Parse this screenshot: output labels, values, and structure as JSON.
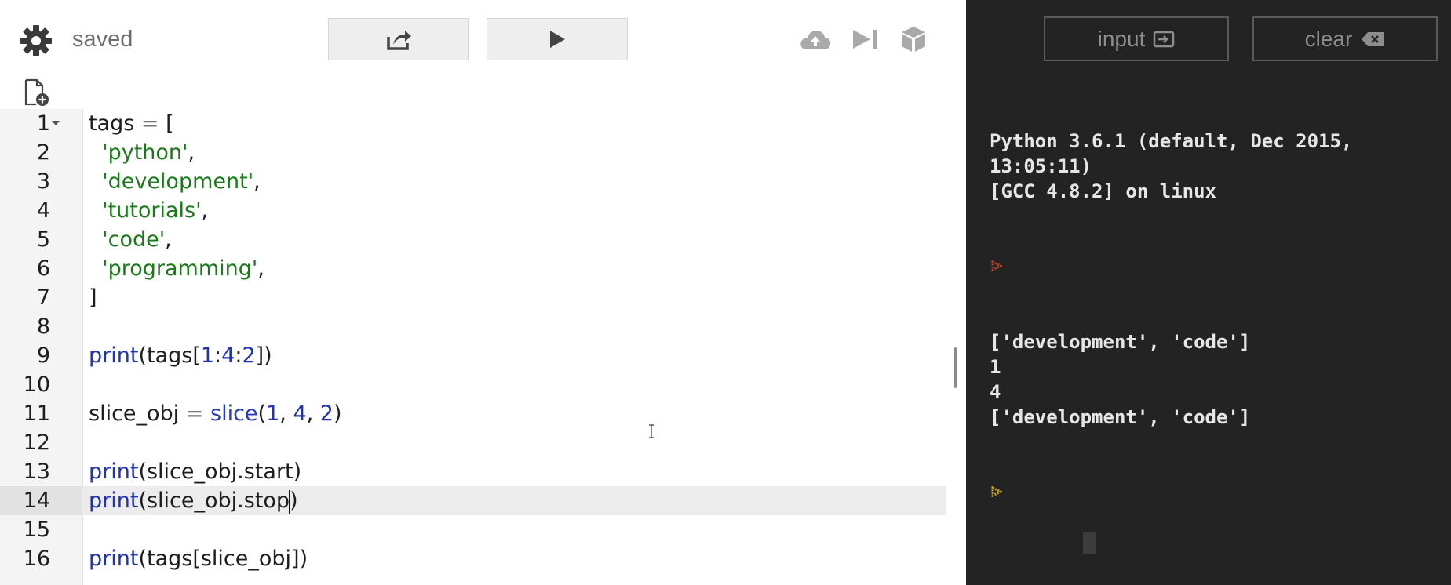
{
  "toolbar": {
    "status": "saved",
    "icons": {
      "settings": "gear-icon",
      "share": "share-icon",
      "run": "play-icon",
      "upload": "cloud-upload-icon",
      "step": "step-forward-icon",
      "package": "cube-icon",
      "new_file": "new-file-icon"
    }
  },
  "editor": {
    "active_line": 14,
    "lines": [
      {
        "n": "1"
      },
      {
        "n": "2"
      },
      {
        "n": "3"
      },
      {
        "n": "4"
      },
      {
        "n": "5"
      },
      {
        "n": "6"
      },
      {
        "n": "7"
      },
      {
        "n": "8"
      },
      {
        "n": "9"
      },
      {
        "n": "10"
      },
      {
        "n": "11"
      },
      {
        "n": "12"
      },
      {
        "n": "13"
      },
      {
        "n": "14"
      },
      {
        "n": "15"
      },
      {
        "n": "16"
      }
    ],
    "code": [
      "tags = [",
      "  'python',",
      "  'development',",
      "  'tutorials',",
      "  'code',",
      "  'programming',",
      "]",
      "",
      "print(tags[1:4:2])",
      "",
      "slice_obj = slice(1, 4, 2)",
      "",
      "print(slice_obj.start)",
      "print(slice_obj.stop)",
      "",
      "print(tags[slice_obj])"
    ]
  },
  "console": {
    "input_label": "input",
    "clear_label": "clear",
    "header": "Python 3.6.1 (default, Dec 2015,\n13:05:11)\n[GCC 4.8.2] on linux",
    "output": [
      "['development', 'code']",
      "1",
      "4",
      "['development', 'code']"
    ],
    "colors": {
      "background": "#232323",
      "prompt_old": "#b0442a",
      "prompt_active": "#c9a227"
    }
  }
}
